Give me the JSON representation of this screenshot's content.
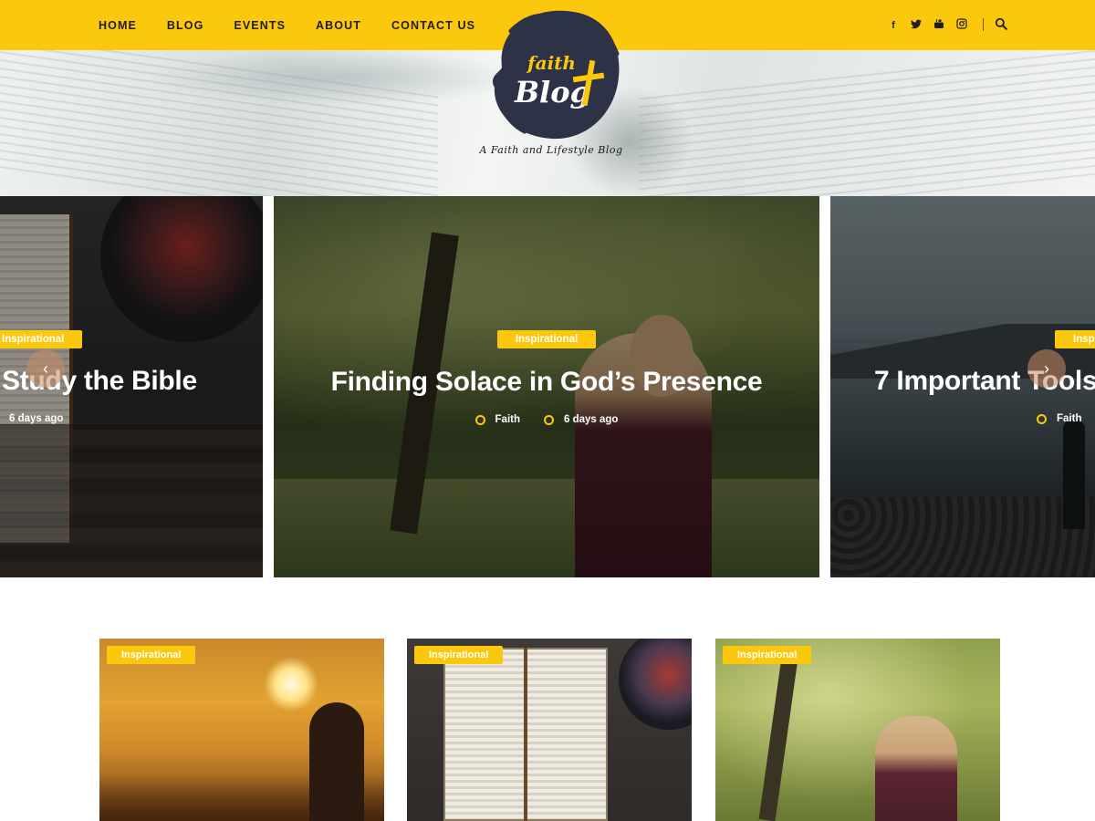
{
  "nav": {
    "items": [
      "HOME",
      "BLOG",
      "EVENTS",
      "ABOUT",
      "CONTACT US"
    ]
  },
  "socials": [
    {
      "icon": "facebook-icon",
      "glyph": "f"
    },
    {
      "icon": "twitter-icon",
      "glyph": "t"
    },
    {
      "icon": "youtube-icon",
      "glyph": "▶"
    },
    {
      "icon": "instagram-icon",
      "glyph": "◎"
    }
  ],
  "logo": {
    "line1": "faith",
    "line2": "Blog",
    "tagline": "A Faith and Lifestyle Blog"
  },
  "slider": {
    "left": {
      "tag": "Inspirational",
      "title": "Study the Bible",
      "date": "6 days ago"
    },
    "center": {
      "tag": "Inspirational",
      "title": "Finding Solace in God’s Presence",
      "author": "Faith",
      "date": "6 days ago"
    },
    "right": {
      "tag": "Inspirational",
      "title": "7 Important Tools",
      "author": "Faith"
    }
  },
  "cards": [
    {
      "tag": "Inspirational"
    },
    {
      "tag": "Inspirational"
    },
    {
      "tag": "Inspirational"
    }
  ],
  "colors": {
    "accent": "#fcc80e",
    "text": "#1e1e1e"
  }
}
